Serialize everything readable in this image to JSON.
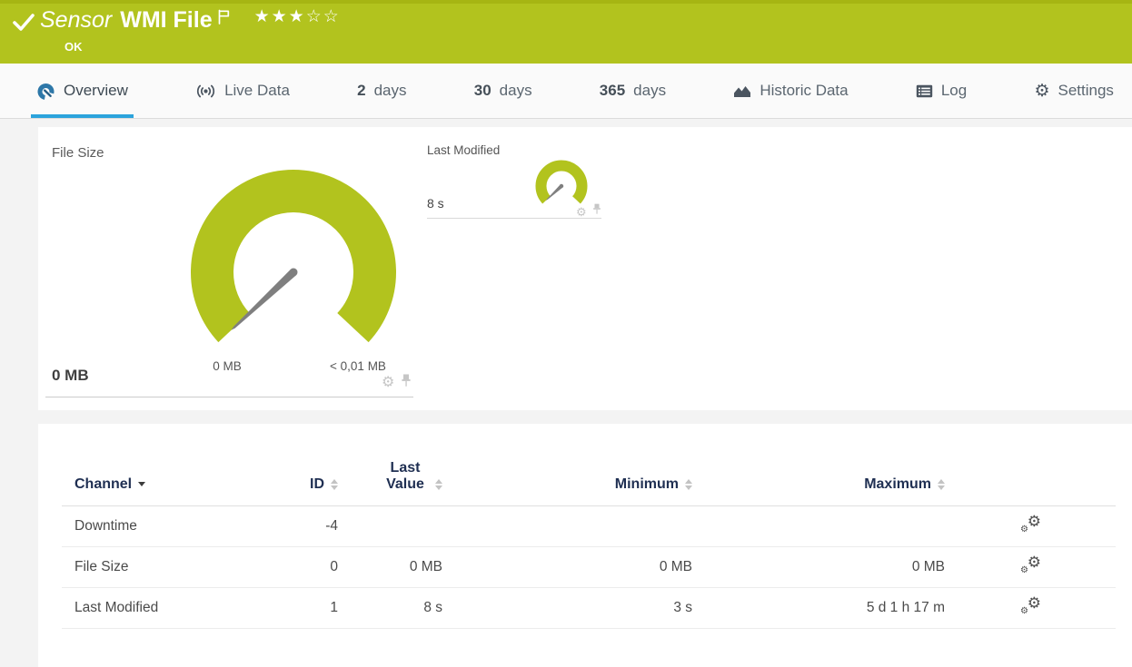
{
  "header": {
    "kind": "Sensor",
    "title": "WMI File",
    "status": "OK",
    "stars_filled": "★★★",
    "stars_empty": "☆☆"
  },
  "tabs": {
    "overview": "Overview",
    "live_data": "Live Data",
    "d2": {
      "num": "2",
      "unit": "days"
    },
    "d30": {
      "num": "30",
      "unit": "days"
    },
    "d365": {
      "num": "365",
      "unit": "days"
    },
    "historic": "Historic Data",
    "log": "Log",
    "settings": "Settings"
  },
  "gauges": {
    "file_size": {
      "title": "File Size",
      "value": "0 MB",
      "scale_min": "0 MB",
      "scale_max": "< 0,01 MB"
    },
    "last_modified": {
      "title": "Last Modified",
      "value": "8 s"
    }
  },
  "table": {
    "headers": {
      "channel": "Channel",
      "id": "ID",
      "last_value": "Last Value",
      "minimum": "Minimum",
      "maximum": "Maximum"
    },
    "rows": [
      {
        "name": "Downtime",
        "id": "-4",
        "last_value": "",
        "minimum": "",
        "maximum": ""
      },
      {
        "name": "File Size",
        "id": "0",
        "last_value": "0 MB",
        "minimum": "0 MB",
        "maximum": "0 MB"
      },
      {
        "name": "Last Modified",
        "id": "1",
        "last_value": "8 s",
        "minimum": "3 s",
        "maximum": "5 d 1 h 17 m"
      }
    ]
  },
  "chart_data": [
    {
      "type": "gauge",
      "title": "File Size",
      "value": 0,
      "unit": "MB",
      "scale_min_label": "0 MB",
      "scale_max_label": "< 0,01 MB",
      "color": "#b2c31e"
    },
    {
      "type": "gauge",
      "title": "Last Modified",
      "value": 8,
      "unit": "s",
      "color": "#b2c31e"
    }
  ],
  "colors": {
    "brand_green": "#b2c31e",
    "active_tab_blue": "#2ba3dc",
    "table_header_navy": "#1f2f52"
  }
}
